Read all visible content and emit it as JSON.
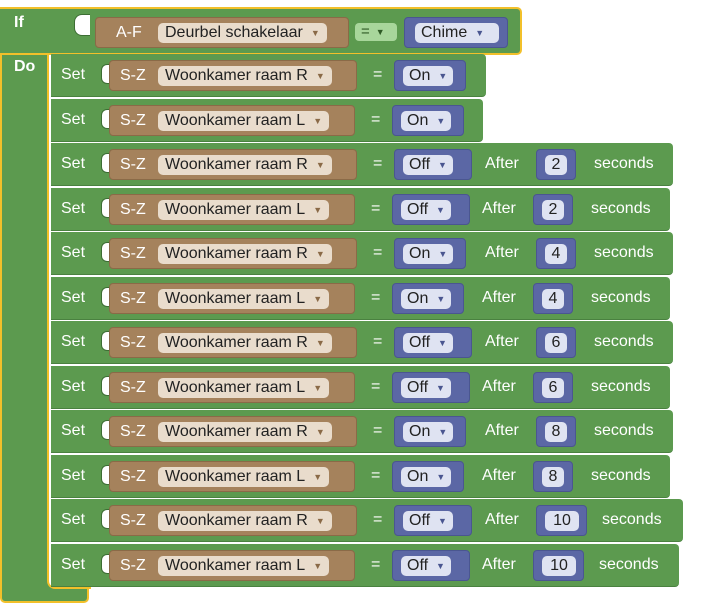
{
  "if_block": {
    "if_label": "If",
    "do_label": "Do",
    "condition": {
      "device_type": "A-F",
      "device_name": "Deurbel schakelaar",
      "operator": "=",
      "value": "Chime"
    }
  },
  "rows": [
    {
      "set": "Set",
      "type": "S-Z",
      "device": "Woonkamer raam R",
      "eq": "=",
      "state": "On"
    },
    {
      "set": "Set",
      "type": "S-Z",
      "device": "Woonkamer raam L",
      "eq": "=",
      "state": "On"
    },
    {
      "set": "Set",
      "type": "S-Z",
      "device": "Woonkamer raam R",
      "eq": "=",
      "state": "Off",
      "after": "After",
      "delay": "2",
      "unit": "seconds"
    },
    {
      "set": "Set",
      "type": "S-Z",
      "device": "Woonkamer raam L",
      "eq": "=",
      "state": "Off",
      "after": "After",
      "delay": "2",
      "unit": "seconds"
    },
    {
      "set": "Set",
      "type": "S-Z",
      "device": "Woonkamer raam R",
      "eq": "=",
      "state": "On",
      "after": "After",
      "delay": "4",
      "unit": "seconds"
    },
    {
      "set": "Set",
      "type": "S-Z",
      "device": "Woonkamer raam L",
      "eq": "=",
      "state": "On",
      "after": "After",
      "delay": "4",
      "unit": "seconds"
    },
    {
      "set": "Set",
      "type": "S-Z",
      "device": "Woonkamer raam R",
      "eq": "=",
      "state": "Off",
      "after": "After",
      "delay": "6",
      "unit": "seconds"
    },
    {
      "set": "Set",
      "type": "S-Z",
      "device": "Woonkamer raam L",
      "eq": "=",
      "state": "Off",
      "after": "After",
      "delay": "6",
      "unit": "seconds"
    },
    {
      "set": "Set",
      "type": "S-Z",
      "device": "Woonkamer raam R",
      "eq": "=",
      "state": "On",
      "after": "After",
      "delay": "8",
      "unit": "seconds"
    },
    {
      "set": "Set",
      "type": "S-Z",
      "device": "Woonkamer raam L",
      "eq": "=",
      "state": "On",
      "after": "After",
      "delay": "8",
      "unit": "seconds"
    },
    {
      "set": "Set",
      "type": "S-Z",
      "device": "Woonkamer raam R",
      "eq": "=",
      "state": "Off",
      "after": "After",
      "delay": "10",
      "unit": "seconds"
    },
    {
      "set": "Set",
      "type": "S-Z",
      "device": "Woonkamer raam L",
      "eq": "=",
      "state": "Off",
      "after": "After",
      "delay": "10",
      "unit": "seconds"
    }
  ],
  "colors": {
    "logic_green": "#5c9a4f",
    "selection_yellow": "#f2c02a",
    "device_brown": "#a5825c",
    "value_blue": "#5b67a5"
  }
}
